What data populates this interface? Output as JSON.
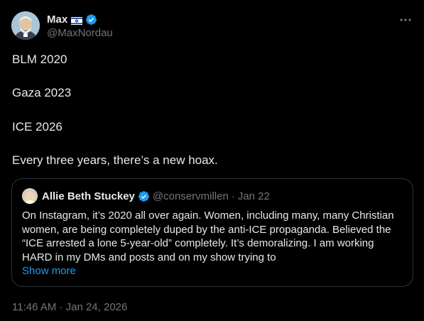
{
  "author": {
    "display_name": "Max",
    "handle": "@MaxNordau",
    "flag_icon": "israel-flag-icon",
    "verified_icon": "verified-badge-icon",
    "more_icon": "more-options-icon"
  },
  "tweet": {
    "lines": [
      "BLM 2020",
      "Gaza 2023",
      "ICE 2026",
      "Every three years, there’s a new hoax."
    ],
    "time": "11:46 AM",
    "separator": "·",
    "date": "Jan 24, 2026"
  },
  "quote": {
    "display_name": "Allie Beth Stuckey",
    "handle": "@conservmillen",
    "separator": "·",
    "date": "Jan 22",
    "lines": [
      "On Instagram, it’s 2020 all over again. Women, including many, many Christian",
      "women, are being completely duped by the anti-ICE propaganda. Believed the",
      "“ICE arrested a lone 5-year-old” completely. It’s demoralizing. I am working",
      "HARD in my DMs and posts and on my show trying to"
    ],
    "show_more": "Show more"
  },
  "colors": {
    "background": "#000000",
    "text": "#e7e9ea",
    "secondary": "#71767b",
    "link": "#1d9bf0",
    "border": "#2f3336",
    "verified": "#1d9bf0"
  }
}
